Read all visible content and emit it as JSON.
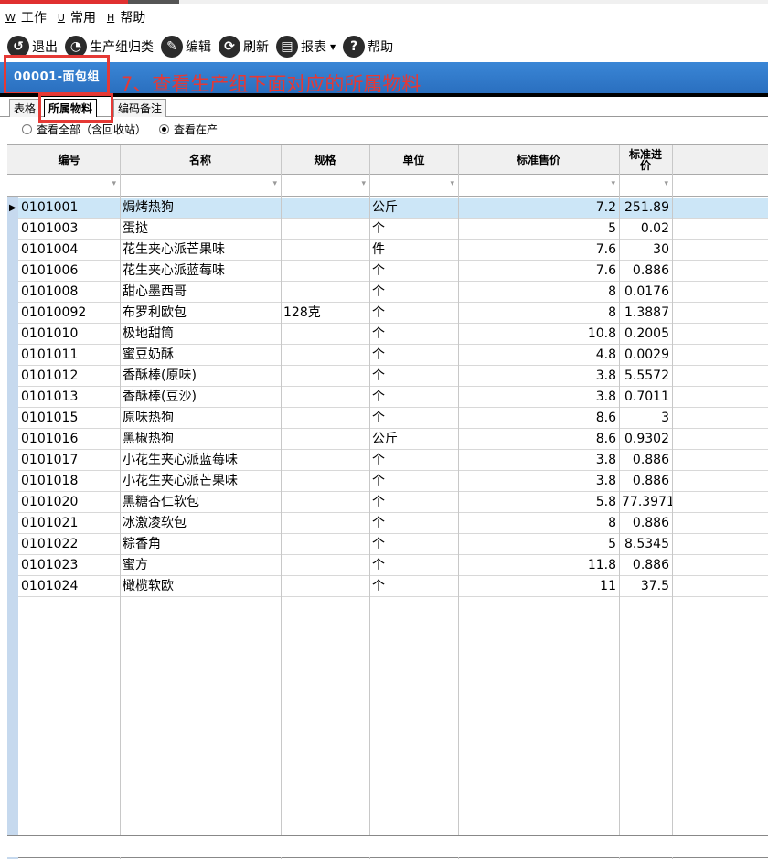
{
  "menu": [
    {
      "key": "W",
      "label": "工作"
    },
    {
      "key": "U",
      "label": "常用"
    },
    {
      "key": "H",
      "label": "帮助"
    }
  ],
  "toolbar": [
    {
      "name": "exit",
      "icon": "undo-icon",
      "glyph": "↺",
      "label": "退出"
    },
    {
      "name": "group-classify",
      "icon": "pie-chart-icon",
      "glyph": "◔",
      "label": "生产组归类"
    },
    {
      "name": "edit",
      "icon": "pencil-icon",
      "glyph": "✎",
      "label": "编辑"
    },
    {
      "name": "refresh",
      "icon": "refresh-icon",
      "glyph": "⟳",
      "label": "刷新"
    },
    {
      "name": "report",
      "icon": "printer-icon",
      "glyph": "▤",
      "label": "报表",
      "has_dropdown": true
    },
    {
      "name": "help",
      "icon": "question-icon",
      "glyph": "?",
      "label": "帮助"
    }
  ],
  "group": {
    "title": "00001-面包组",
    "annotation": "7、查看生产组下面对应的所属物料",
    "accent_color": "#2a6fbf",
    "annotation_color": "#e53935"
  },
  "tabs": [
    "表格",
    "所属物料",
    "编码备注"
  ],
  "active_tab": "所属物料",
  "filters": {
    "options": [
      "查看全部（含回收站）",
      "查看在产"
    ],
    "selected": "查看在产"
  },
  "table": {
    "columns": [
      "编号",
      "名称",
      "规格",
      "单位",
      "标准售价",
      "标准进价"
    ],
    "selected_row": 0,
    "rows": [
      [
        "0101001",
        "焗烤热狗",
        "",
        "公斤",
        "7.2",
        "251.89"
      ],
      [
        "0101003",
        "蛋挞",
        "",
        "个",
        "5",
        "0.02"
      ],
      [
        "0101004",
        "花生夹心派芒果味",
        "",
        "件",
        "7.6",
        "30"
      ],
      [
        "0101006",
        "花生夹心派蓝莓味",
        "",
        "个",
        "7.6",
        "0.886"
      ],
      [
        "0101008",
        "甜心墨西哥",
        "",
        "个",
        "8",
        "0.0176"
      ],
      [
        "01010092",
        "布罗利欧包",
        "128克",
        "个",
        "8",
        "1.3887"
      ],
      [
        "0101010",
        "极地甜筒",
        "",
        "个",
        "10.8",
        "0.2005"
      ],
      [
        "0101011",
        "蜜豆奶酥",
        "",
        "个",
        "4.8",
        "0.0029"
      ],
      [
        "0101012",
        "香酥棒(原味)",
        "",
        "个",
        "3.8",
        "5.5572"
      ],
      [
        "0101013",
        "香酥棒(豆沙)",
        "",
        "个",
        "3.8",
        "0.7011"
      ],
      [
        "0101015",
        "原味热狗",
        "",
        "个",
        "8.6",
        "3"
      ],
      [
        "0101016",
        "黑椒热狗",
        "",
        "公斤",
        "8.6",
        "0.9302"
      ],
      [
        "0101017",
        "小花生夹心派蓝莓味",
        "",
        "个",
        "3.8",
        "0.886"
      ],
      [
        "0101018",
        "小花生夹心派芒果味",
        "",
        "个",
        "3.8",
        "0.886"
      ],
      [
        "0101020",
        "黑糖杏仁软包",
        "",
        "个",
        "5.8",
        "77.3971"
      ],
      [
        "0101021",
        "冰激凌软包",
        "",
        "个",
        "8",
        "0.886"
      ],
      [
        "0101022",
        "粽香角",
        "",
        "个",
        "5",
        "8.5345"
      ],
      [
        "0101023",
        "蜜方",
        "",
        "个",
        "11.8",
        "0.886"
      ],
      [
        "0101024",
        "橄榄软欧",
        "",
        "个",
        "11",
        "37.5"
      ]
    ]
  }
}
